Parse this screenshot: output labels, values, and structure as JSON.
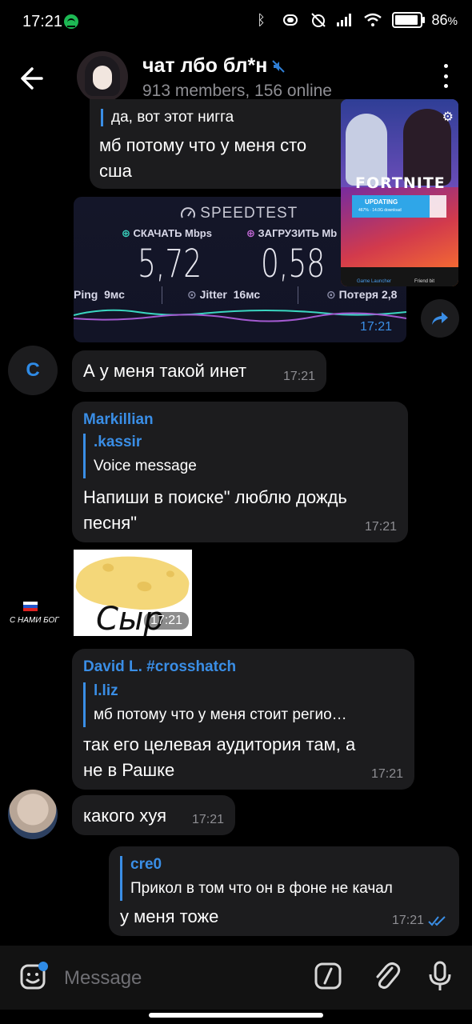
{
  "status_bar": {
    "time": "17:21",
    "battery": "86",
    "battery_unit": "%"
  },
  "header": {
    "title": "чат лбо бл*н",
    "subtitle": "913 members, 156 online"
  },
  "messages": {
    "partial_top": {
      "reply_text": "да, вот этот нигга",
      "text_line1": "мб потому что у меня сто",
      "text_line2": "сша"
    },
    "speedtest": {
      "logo": "SPEEDTEST",
      "download_label": "СКАЧАТЬ Mbps",
      "upload_label": "ЗАГРУЗИТЬ Mb",
      "download_value": "5,72",
      "upload_value": "0,58",
      "ping_label": "Ping",
      "ping_value": "9мс",
      "jitter_label": "Jitter",
      "jitter_value": "16мс",
      "loss_label": "Потеря",
      "loss_value": "2,8",
      "time": "17:21"
    },
    "c_message": {
      "avatar_letter": "C",
      "text": "А у меня такой инет",
      "time": "17:21"
    },
    "markillian": {
      "sender": "Markillian",
      "reply_name": ".kassir",
      "reply_text": "Voice message",
      "text": "Напиши в поиске\" люблю дождь песня\"",
      "time": "17:21"
    },
    "sticker": {
      "text": "Сыр",
      "time": "17:21",
      "avatar_caption": "С НАМИ БОГ"
    },
    "david": {
      "sender": "David L. #crosshatch",
      "reply_name": "l.liz",
      "reply_text": "мб потому что у меня стоит регио…",
      "text": "так его целевая аудитория там, а не в Рашке",
      "time": "17:21"
    },
    "face_message": {
      "text": "какого хуя",
      "time": "17:21"
    },
    "own_message": {
      "reply_name": "cre0",
      "reply_text": "Прикол в том что он в фоне не качал",
      "text": "у меня тоже",
      "time": "17:21"
    }
  },
  "overlay": {
    "title": "FORTNITE",
    "status": "UPDATING",
    "progress_text": "467% · 14.0G download",
    "progress": 0.82,
    "nav_left": "Game Launcher",
    "nav_right": "Friend bit"
  },
  "input": {
    "placeholder": "Message"
  },
  "colors": {
    "accent": "#3a8ee6",
    "bubble": "#1c1c1e",
    "background": "#000000",
    "spotify": "#1db954"
  },
  "icons": [
    "back-arrow-icon",
    "mute-icon",
    "menu-dots-icon",
    "share-icon",
    "emoji-icon",
    "command-icon",
    "attach-icon",
    "mic-icon",
    "read-check-icon"
  ]
}
